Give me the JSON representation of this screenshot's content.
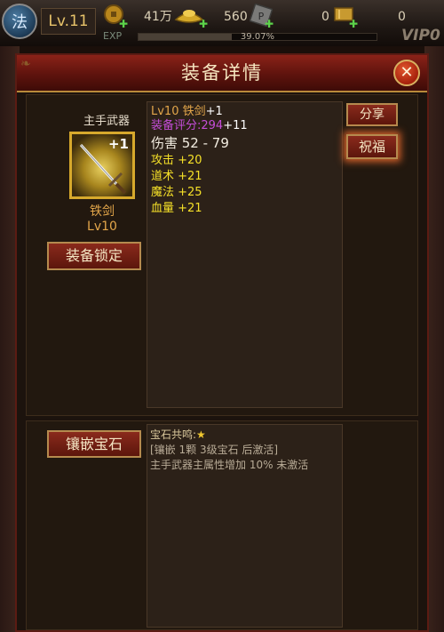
{
  "hud": {
    "class_glyph": "法",
    "level": "Lv.11",
    "gold": "41万",
    "ingot": "560",
    "bars": "0",
    "extra": "0",
    "exp_label": "EXP",
    "exp_percent": "39.07%",
    "exp_fraction": 0.3907,
    "vip": "VIP0"
  },
  "dialog": {
    "title": "装备详情",
    "close_icon": "close-icon"
  },
  "item": {
    "slot": "主手武器",
    "plus": "+1",
    "name": "铁剑",
    "level": "Lv10",
    "icon": "sword-icon"
  },
  "buttons": {
    "lock": "装备锁定",
    "share": "分享",
    "bless": "祝福",
    "inlay": "镶嵌宝石"
  },
  "stats": {
    "header_name": "Lv10 铁剑",
    "header_plus": "+1",
    "score_label": "装备评分:294",
    "score_plus": "+11",
    "damage": "伤害 52 - 79",
    "attack": "攻击 +20",
    "taoism": "道术 +21",
    "magic": "魔法 +25",
    "hp": "血量 +21"
  },
  "gem": {
    "title": "宝石共鸣:",
    "condition": "[镶嵌 1颗 3级宝石 后激活]",
    "effect": "主手武器主属性增加 10% 未激活"
  },
  "colors": {
    "gold_text": "#e3a64a",
    "score_purple": "#c44dd8",
    "stat_yellow": "#f5e028",
    "title_red": "#6b1610"
  }
}
